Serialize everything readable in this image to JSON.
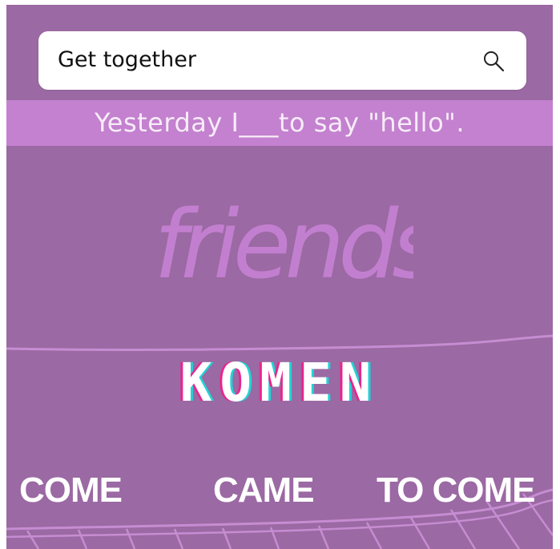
{
  "search": {
    "query": "Get together",
    "icon": "search-icon"
  },
  "question": {
    "text": "Yesterday I___to say \"hello\"."
  },
  "decoration": {
    "word": "friends"
  },
  "brand": {
    "name": "KOMEN"
  },
  "options": [
    {
      "label": "COME"
    },
    {
      "label": "CAME"
    },
    {
      "label": "TO COME"
    }
  ],
  "colors": {
    "background": "#9b69a3",
    "band": "#c381cf",
    "line": "#c68dd2",
    "glitch_pink": "#e8258f",
    "glitch_cyan": "#23d3d6"
  }
}
